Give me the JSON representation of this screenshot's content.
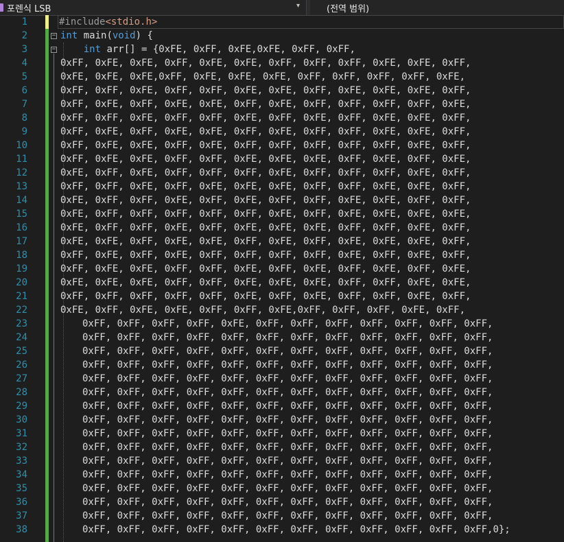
{
  "toolbar": {
    "project_label": "포렌식 LSB",
    "scope_label": "(전역 범위)",
    "dropdown_icon": "chevron-down-icon"
  },
  "editor": {
    "line_numbers": [
      "1",
      "2",
      "3",
      "4",
      "5",
      "6",
      "7",
      "8",
      "9",
      "10",
      "11",
      "12",
      "13",
      "14",
      "15",
      "16",
      "17",
      "18",
      "19",
      "20",
      "21",
      "22",
      "23",
      "24",
      "25",
      "26",
      "27",
      "28",
      "29",
      "30",
      "31",
      "32",
      "33",
      "34",
      "35",
      "36",
      "37",
      "38"
    ],
    "lines": [
      [
        {
          "t": "#include",
          "c": "pp"
        },
        {
          "t": "<stdio.h>",
          "c": "str"
        }
      ],
      [
        {
          "t": "int",
          "c": "kw"
        },
        {
          "t": " main("
        },
        {
          "t": "void",
          "c": "kw"
        },
        {
          "t": ") {"
        }
      ],
      [
        {
          "t": "    "
        },
        {
          "t": "int",
          "c": "kw"
        },
        {
          "t": " arr[] = {0xFE, 0xFF, 0xFE,0xFE, 0xFF, 0xFF,"
        }
      ],
      [
        {
          "t": "0xFF, 0xFE, 0xFE, 0xFF, 0xFE, 0xFE, 0xFF, 0xFF, 0xFF, 0xFE, 0xFE, 0xFF,"
        }
      ],
      [
        {
          "t": "0xFE, 0xFE, 0xFE,0xFF, 0xFE, 0xFE, 0xFE, 0xFF, 0xFF, 0xFF, 0xFF, 0xFE,"
        }
      ],
      [
        {
          "t": "0xFF, 0xFF, 0xFE, 0xFF, 0xFF, 0xFE, 0xFE, 0xFF, 0xFE, 0xFE, 0xFE, 0xFF,"
        }
      ],
      [
        {
          "t": "0xFF, 0xFE, 0xFF, 0xFE, 0xFE, 0xFF, 0xFE, 0xFF, 0xFF, 0xFF, 0xFF, 0xFE,"
        }
      ],
      [
        {
          "t": "0xFF, 0xFF, 0xFE, 0xFF, 0xFF, 0xFE, 0xFF, 0xFE, 0xFF, 0xFE, 0xFE, 0xFF,"
        }
      ],
      [
        {
          "t": "0xFF, 0xFE, 0xFF, 0xFE, 0xFE, 0xFF, 0xFE, 0xFF, 0xFF, 0xFE, 0xFE, 0xFF,"
        }
      ],
      [
        {
          "t": "0xFF, 0xFE, 0xFE, 0xFF, 0xFE, 0xFF, 0xFF, 0xFF, 0xFF, 0xFF, 0xFE, 0xFF,"
        }
      ],
      [
        {
          "t": "0xFF, 0xFE, 0xFE, 0xFF, 0xFF, 0xFE, 0xFE, 0xFE, 0xFF, 0xFE, 0xFF, 0xFE,"
        }
      ],
      [
        {
          "t": "0xFE, 0xFF, 0xFE, 0xFF, 0xFF, 0xFF, 0xFE, 0xFF, 0xFF, 0xFF, 0xFE, 0xFF,"
        }
      ],
      [
        {
          "t": "0xFF, 0xFF, 0xFE, 0xFF, 0xFE, 0xFE, 0xFE, 0xFF, 0xFF, 0xFE, 0xFE, 0xFF,"
        }
      ],
      [
        {
          "t": "0xFE, 0xFF, 0xFF, 0xFE, 0xFF, 0xFE, 0xFF, 0xFF, 0xFE, 0xFE, 0xFF, 0xFF,"
        }
      ],
      [
        {
          "t": "0xFE, 0xFF, 0xFF, 0xFF, 0xFF, 0xFF, 0xFE, 0xFF, 0xFE, 0xFE, 0xFE, 0xFE,"
        }
      ],
      [
        {
          "t": "0xFE, 0xFF, 0xFF, 0xFE, 0xFF, 0xFE, 0xFE, 0xFE, 0xFF, 0xFF, 0xFE, 0xFF,"
        }
      ],
      [
        {
          "t": "0xFE, 0xFE, 0xFF, 0xFE, 0xFE, 0xFF, 0xFE, 0xFF, 0xFE, 0xFE, 0xFE, 0xFF,"
        }
      ],
      [
        {
          "t": "0xFF, 0xFE, 0xFF, 0xFE, 0xFF, 0xFF, 0xFF, 0xFF, 0xFE, 0xFF, 0xFE, 0xFF,"
        }
      ],
      [
        {
          "t": "0xFF, 0xFE, 0xFE, 0xFF, 0xFF, 0xFE, 0xFF, 0xFE, 0xFF, 0xFE, 0xFF, 0xFE,"
        }
      ],
      [
        {
          "t": "0xFE, 0xFE, 0xFE, 0xFF, 0xFF, 0xFE, 0xFE, 0xFE, 0xFF, 0xFF, 0xFE, 0xFE,"
        }
      ],
      [
        {
          "t": "0xFF, 0xFF, 0xFF, 0xFF, 0xFF, 0xFE, 0xFF, 0xFE, 0xFF, 0xFF, 0xFE, 0xFF,"
        }
      ],
      [
        {
          "t": "0xFE, 0xFF, 0xFE, 0xFE, 0xFF, 0xFF, 0xFE,0xFF, 0xFF, 0xFF, 0xFE, 0xFF,"
        }
      ],
      [
        {
          "t": "0xFF, 0xFF, 0xFF, 0xFF, 0xFE, 0xFF, 0xFF, 0xFF, 0xFF, 0xFF, 0xFF, 0xFF,"
        }
      ],
      [
        {
          "t": "0xFF, 0xFF, 0xFF, 0xFF, 0xFF, 0xFF, 0xFF, 0xFF, 0xFF, 0xFF, 0xFF, 0xFF,"
        }
      ],
      [
        {
          "t": "0xFF, 0xFF, 0xFF, 0xFF, 0xFF, 0xFF, 0xFF, 0xFF, 0xFF, 0xFF, 0xFF, 0xFF,"
        }
      ],
      [
        {
          "t": "0xFF, 0xFF, 0xFF, 0xFF, 0xFF, 0xFF, 0xFF, 0xFF, 0xFF, 0xFF, 0xFF, 0xFF,"
        }
      ],
      [
        {
          "t": "0xFF, 0xFF, 0xFF, 0xFF, 0xFF, 0xFF, 0xFF, 0xFF, 0xFF, 0xFF, 0xFF, 0xFF,"
        }
      ],
      [
        {
          "t": "0xFF, 0xFF, 0xFF, 0xFF, 0xFF, 0xFF, 0xFF, 0xFF, 0xFF, 0xFF, 0xFF, 0xFF,"
        }
      ],
      [
        {
          "t": "0xFF, 0xFF, 0xFF, 0xFF, 0xFF, 0xFF, 0xFF, 0xFF, 0xFF, 0xFF, 0xFF, 0xFF,"
        }
      ],
      [
        {
          "t": "0xFF, 0xFF, 0xFF, 0xFF, 0xFF, 0xFF, 0xFF, 0xFF, 0xFF, 0xFF, 0xFF, 0xFF,"
        }
      ],
      [
        {
          "t": "0xFF, 0xFF, 0xFF, 0xFF, 0xFF, 0xFF, 0xFF, 0xFF, 0xFF, 0xFF, 0xFF, 0xFF,"
        }
      ],
      [
        {
          "t": "0xFF, 0xFF, 0xFF, 0xFF, 0xFF, 0xFF, 0xFF, 0xFF, 0xFF, 0xFF, 0xFF, 0xFF,"
        }
      ],
      [
        {
          "t": "0xFF, 0xFF, 0xFF, 0xFF, 0xFF, 0xFF, 0xFF, 0xFF, 0xFF, 0xFF, 0xFF, 0xFF,"
        }
      ],
      [
        {
          "t": "0xFF, 0xFF, 0xFF, 0xFF, 0xFF, 0xFF, 0xFF, 0xFF, 0xFF, 0xFF, 0xFF, 0xFF,"
        }
      ],
      [
        {
          "t": "0xFF, 0xFF, 0xFF, 0xFF, 0xFF, 0xFF, 0xFF, 0xFF, 0xFF, 0xFF, 0xFF, 0xFF,"
        }
      ],
      [
        {
          "t": "0xFF, 0xFF, 0xFF, 0xFF, 0xFF, 0xFF, 0xFF, 0xFF, 0xFF, 0xFF, 0xFF, 0xFF,"
        }
      ],
      [
        {
          "t": "0xFF, 0xFF, 0xFF, 0xFF, 0xFF, 0xFF, 0xFF, 0xFF, 0xFF, 0xFF, 0xFF, 0xFF,"
        }
      ],
      [
        {
          "t": "0xFF, 0xFF, 0xFF, 0xFF, 0xFF, 0xFF, 0xFF, 0xFF, 0xFF, 0xFF, 0xFF, 0xFF,0};"
        }
      ]
    ],
    "colors": {
      "background": "#1e1e1e",
      "keyword": "#569cd6",
      "string": "#d69d85",
      "preprocessor": "#9b9b9b",
      "line_number": "#2b91af",
      "change_saved": "#57a64a",
      "change_unsaved": "#efef91"
    }
  }
}
